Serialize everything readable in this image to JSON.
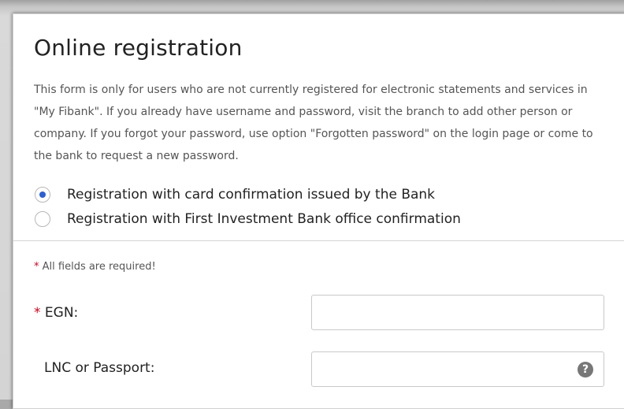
{
  "form": {
    "title": "Online registration",
    "intro": "This form is only for users who are not currently registered for electronic statements and services in \"My Fibank\". If you already have username and password, visit the branch to add other person or company. If you forgot your password, use option \"Forgotten password\" on the login page or come to the bank to request a new password.",
    "options": [
      {
        "label": "Registration with card confirmation issued by the Bank",
        "checked": true
      },
      {
        "label": "Registration with First Investment Bank office confirmation",
        "checked": false
      }
    ],
    "required_mark": "*",
    "required_note": "All fields are required!",
    "fields": {
      "egn": {
        "label": "EGN:",
        "value": "",
        "required": true
      },
      "lnc": {
        "label": "LNC or Passport:",
        "value": "",
        "help_icon": "question-circle-icon",
        "help_glyph": "?"
      }
    }
  },
  "colors": {
    "accent": "#2b5fd3",
    "required": "#d0021b"
  }
}
